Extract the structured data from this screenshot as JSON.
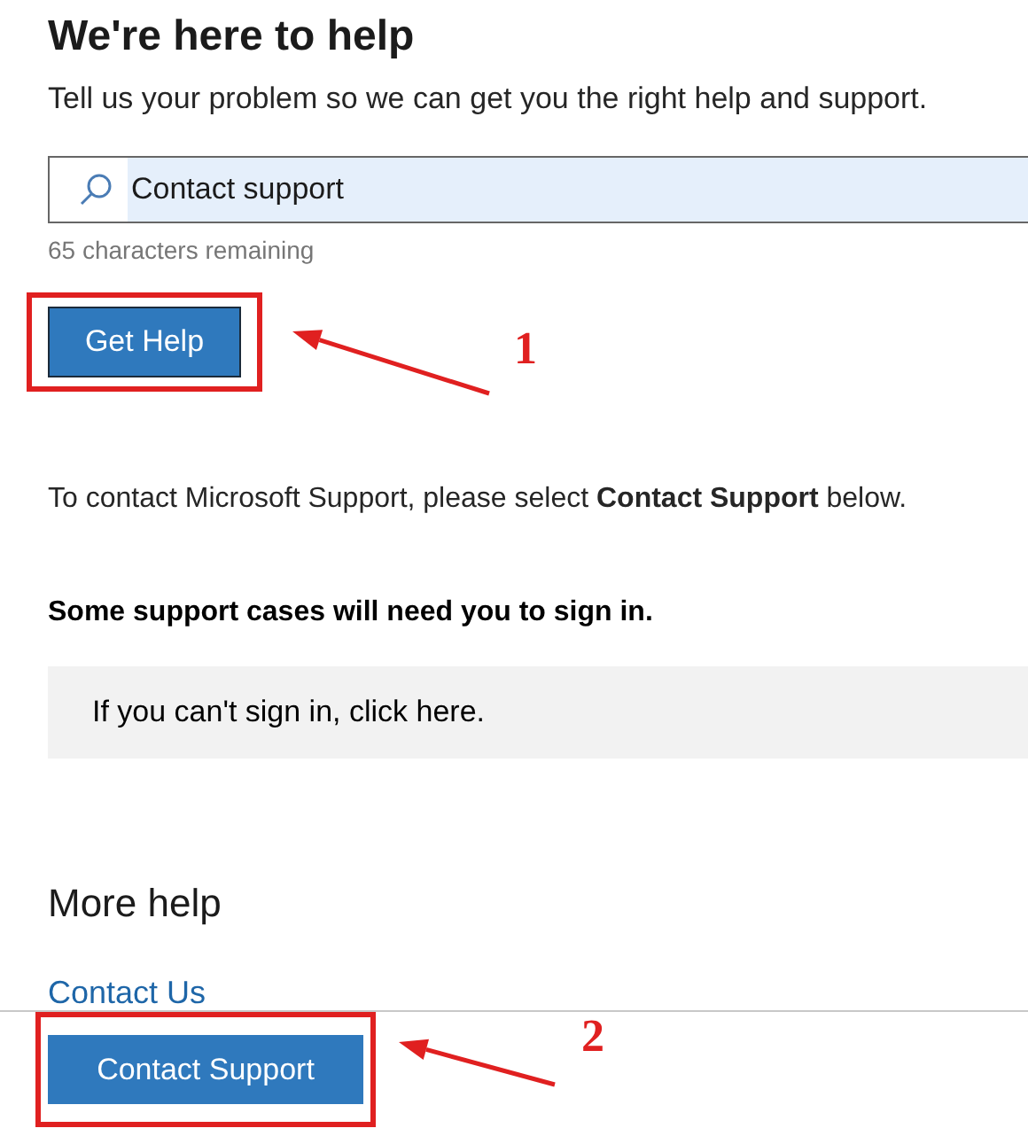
{
  "title": "We're here to help",
  "subtitle": "Tell us your problem so we can get you the right help and support.",
  "search": {
    "value": "Contact support"
  },
  "counter": "65 characters remaining",
  "get_help_button": "Get Help",
  "contact_note": "To contact Microsoft Support, please select **Contact Support** below.",
  "sign_in_note": "Some support cases will need you to sign in.",
  "sign_in_link": "If you can't sign in, click here.",
  "more_help": {
    "heading": "More help",
    "link": "Contact Us"
  },
  "contact_support_button": "Contact Support",
  "annotations": [
    {
      "label": "1"
    },
    {
      "label": "2"
    }
  ]
}
